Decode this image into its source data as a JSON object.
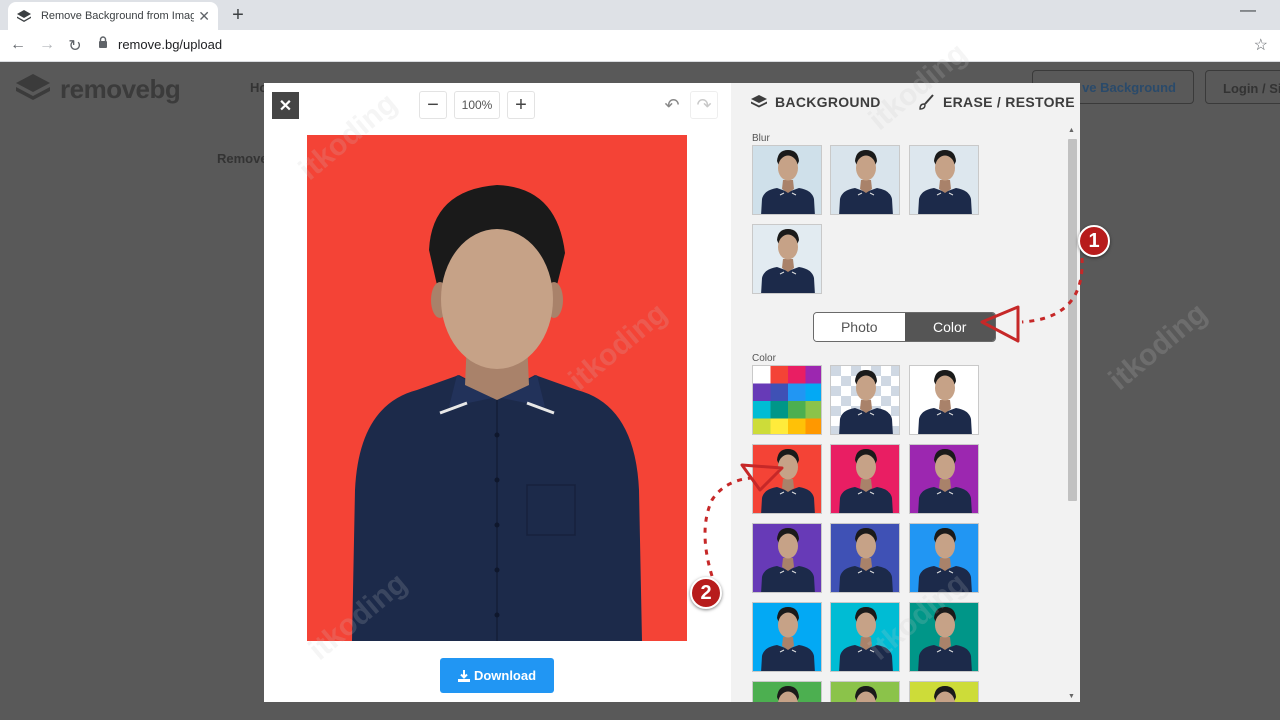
{
  "browser": {
    "tab_title": "Remove Background from Image",
    "tab_close": "✕",
    "new_tab": "+",
    "window_minimize": "—",
    "url": "remove.bg/upload",
    "nav_back": "←",
    "nav_forward": "→",
    "nav_reload": "↻",
    "bookmark": "☆"
  },
  "site": {
    "logo_text": "removebg",
    "nav_fragment": "Ho",
    "content_fragment": "Remove",
    "remove_background_button": "ve Background",
    "login_button": "Login / Si"
  },
  "editor": {
    "close": "✕",
    "zoom_out": "−",
    "zoom_level": "100%",
    "zoom_in": "+",
    "undo": "↶",
    "redo": "↷",
    "download_label": "Download",
    "canvas_background": "#f44336"
  },
  "panel": {
    "tabs": [
      {
        "label": "BACKGROUND",
        "icon": "layers-icon"
      },
      {
        "label": "ERASE / RESTORE",
        "icon": "brush-icon"
      }
    ],
    "blur_label": "Blur",
    "color_label": "Color",
    "toggle": {
      "options": [
        "Photo",
        "Color"
      ],
      "selected": "Color"
    },
    "color_swatches": [
      "#f44336",
      "#e91e63",
      "#9c27b0",
      "#673ab7",
      "#3f51b5",
      "#2196f3",
      "#03a9f4",
      "#00bcd4",
      "#009688",
      "#4caf50",
      "#8bc34a",
      "#cddc39"
    ]
  },
  "annotations": {
    "marker_1": "1",
    "marker_2": "2",
    "watermark": "itkoding"
  }
}
